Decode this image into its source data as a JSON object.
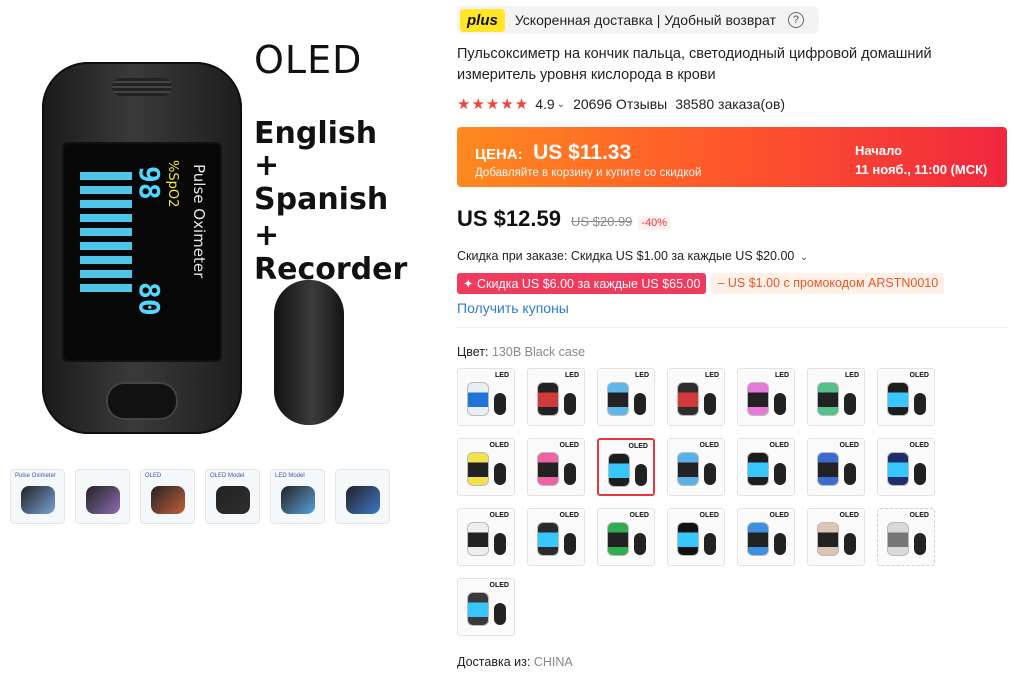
{
  "gallery": {
    "promo": {
      "oled": "OLED",
      "line1": "English",
      "line2": "+",
      "line3": "Spanish",
      "line4": "+",
      "line5": "Recorder"
    },
    "screen": {
      "device_label": "Pulse Oximeter",
      "spo2_label": "%SpO2",
      "spo2_value": "98",
      "pr_label": "PR bpm",
      "pr_value": "80"
    },
    "thumbnails": [
      {
        "title": "Pulse Oximeter",
        "color": "#7aa3d8"
      },
      {
        "title": "",
        "color": "#8d6db2"
      },
      {
        "title": "OLED",
        "color": "#c25f3c"
      },
      {
        "title": "OLED Model",
        "color": "#2e2e2e"
      },
      {
        "title": "LED Model",
        "color": "#5aa0d8"
      },
      {
        "title": "",
        "color": "#3c78c8"
      }
    ]
  },
  "plus_bar": {
    "logo": "plus",
    "text": "Ускоренная доставка | Удобный возврат",
    "help": "?"
  },
  "product": {
    "title": "Пульсоксиметр на кончик пальца, светодиодный цифровой домашний измеритель уровня кислорода в крови",
    "rating": {
      "stars": "★★★★★",
      "value": "4.9",
      "reviews": "20696 Отзывы",
      "orders": "38580 заказа(ов)"
    }
  },
  "sale": {
    "price_label": "ЦЕНА:",
    "price_value": "US $11.33",
    "subtitle": "Добавляйте в корзину и купите со скидкой",
    "start_label": "Начало",
    "start_time": "11 нояб., 11:00 (МСК)"
  },
  "pricing": {
    "current": "US $12.59",
    "old": "US $20.99",
    "discount": "-40%"
  },
  "order_discount": "Скидка при заказе: Скидка US $1.00 за каждые US $20.00",
  "coupons": {
    "red": "✦ Скидка US $6.00 за каждые US $65.00",
    "orange": "– US $1.00 с промокодом ARSTN0010",
    "get_link": "Получить купоны"
  },
  "color": {
    "label": "Цвет:",
    "value": "130B Black case",
    "variants": [
      {
        "tag": "LED",
        "body": "#e8eef5",
        "screen": "#1e74d6"
      },
      {
        "tag": "LED",
        "body": "#222222",
        "screen": "#d03a3a"
      },
      {
        "tag": "LED",
        "body": "#5fb6ea",
        "screen": "#222222"
      },
      {
        "tag": "LED",
        "body": "#2d2d2d",
        "screen": "#d03a3a"
      },
      {
        "tag": "LED",
        "body": "#e57ad8",
        "screen": "#222222"
      },
      {
        "tag": "LED",
        "body": "#56c08a",
        "screen": "#222222"
      },
      {
        "tag": "OLED",
        "body": "#1d1d1d",
        "screen": "#38c6ff"
      },
      {
        "tag": "OLED",
        "body": "#f5e24a",
        "screen": "#222222"
      },
      {
        "tag": "OLED",
        "body": "#f062a6",
        "screen": "#222222"
      },
      {
        "tag": "OLED",
        "body": "#1d1d1d",
        "screen": "#38c6ff"
      },
      {
        "tag": "OLED",
        "body": "#5ab0e8",
        "screen": "#222222"
      },
      {
        "tag": "OLED",
        "body": "#1d1d1d",
        "screen": "#38c6ff"
      },
      {
        "tag": "OLED",
        "body": "#3a6bd0",
        "screen": "#222222"
      },
      {
        "tag": "OLED",
        "body": "#1f2d6b",
        "screen": "#38c6ff"
      },
      {
        "tag": "OLED",
        "body": "#eeeeee",
        "screen": "#222222"
      },
      {
        "tag": "OLED",
        "body": "#2a2a2a",
        "screen": "#38c6ff"
      },
      {
        "tag": "OLED",
        "body": "#2fae4e",
        "screen": "#222222"
      },
      {
        "tag": "OLED",
        "body": "#111111",
        "screen": "#38c6ff"
      },
      {
        "tag": "OLED",
        "body": "#3d8fe0",
        "screen": "#222222"
      },
      {
        "tag": "OLED",
        "body": "#d9c7b3",
        "screen": "#222222"
      },
      {
        "tag": "OLED",
        "body": "#d9d9d9",
        "screen": "#777777"
      },
      {
        "tag": "OLED",
        "body": "#3a3a3a",
        "screen": "#38c6ff"
      }
    ]
  },
  "shipping": {
    "label": "Доставка из:",
    "value": "CHINA"
  }
}
